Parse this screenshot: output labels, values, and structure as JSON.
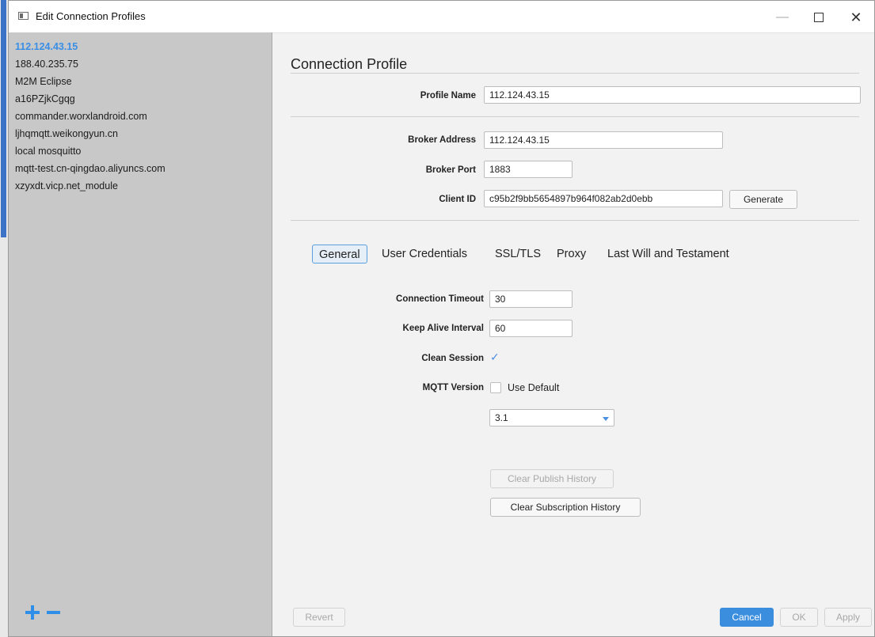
{
  "window": {
    "title": "Edit Connection Profiles"
  },
  "sidebar": {
    "profiles": [
      "112.124.43.15",
      "188.40.235.75",
      "M2M Eclipse",
      "a16PZjkCgqg",
      "commander.worxlandroid.com",
      "ljhqmqtt.weikongyun.cn",
      "local mosquitto",
      "mqtt-test.cn-qingdao.aliyuncs.com",
      "xzyxdt.vicp.net_module"
    ],
    "selected_index": 0
  },
  "profile": {
    "section_title": "Connection Profile",
    "profile_name_label": "Profile Name",
    "profile_name_value": "112.124.43.15",
    "broker_address_label": "Broker Address",
    "broker_address_value": "112.124.43.15",
    "broker_port_label": "Broker Port",
    "broker_port_value": "1883",
    "client_id_label": "Client ID",
    "client_id_value": "c95b2f9bb5654897b964f082ab2d0ebb",
    "generate_label": "Generate"
  },
  "tabs": [
    "General",
    "User Credentials",
    "SSL/TLS",
    "Proxy",
    "Last Will and Testament"
  ],
  "active_tab": "General",
  "general": {
    "connection_timeout_label": "Connection Timeout",
    "connection_timeout_value": "30",
    "keep_alive_label": "Keep Alive Interval",
    "keep_alive_value": "60",
    "clean_session_label": "Clean Session",
    "clean_session_checked": true,
    "mqtt_version_label": "MQTT Version",
    "use_default_label": "Use Default",
    "use_default_checked": false,
    "mqtt_version_selected": "3.1",
    "clear_publish_label": "Clear Publish History",
    "clear_subscription_label": "Clear Subscription History"
  },
  "footer": {
    "revert_label": "Revert",
    "cancel_label": "Cancel",
    "ok_label": "OK",
    "apply_label": "Apply"
  },
  "colors": {
    "accent": "#3b8ede",
    "sidebar_bg": "#c8c8c8",
    "selected_text": "#3a8ee6"
  }
}
